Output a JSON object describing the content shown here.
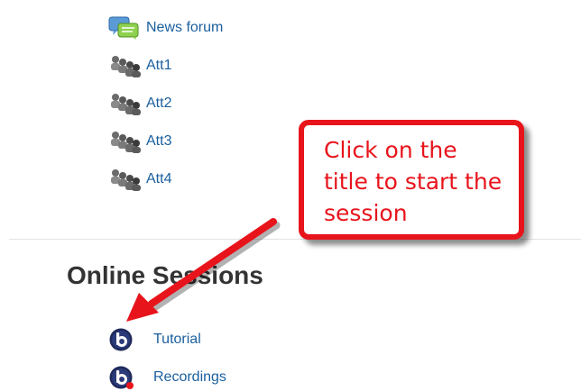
{
  "activities": [
    {
      "label": "News forum",
      "icon": "forum-icon"
    },
    {
      "label": "Att1",
      "icon": "attendance-icon"
    },
    {
      "label": "Att2",
      "icon": "attendance-icon"
    },
    {
      "label": "Att3",
      "icon": "attendance-icon"
    },
    {
      "label": "Att4",
      "icon": "attendance-icon"
    }
  ],
  "section": {
    "title": "Online Sessions",
    "items": [
      {
        "label": "Tutorial",
        "icon": "bigbluebutton-icon"
      },
      {
        "label": "Recordings",
        "icon": "bigbluebutton-recordings-icon"
      }
    ]
  },
  "callout": {
    "text": "Click on the title to start the session",
    "color": "#e8141c"
  },
  "colors": {
    "link": "#1a5f9e",
    "heading": "#333333",
    "accent_red": "#e8141c"
  }
}
